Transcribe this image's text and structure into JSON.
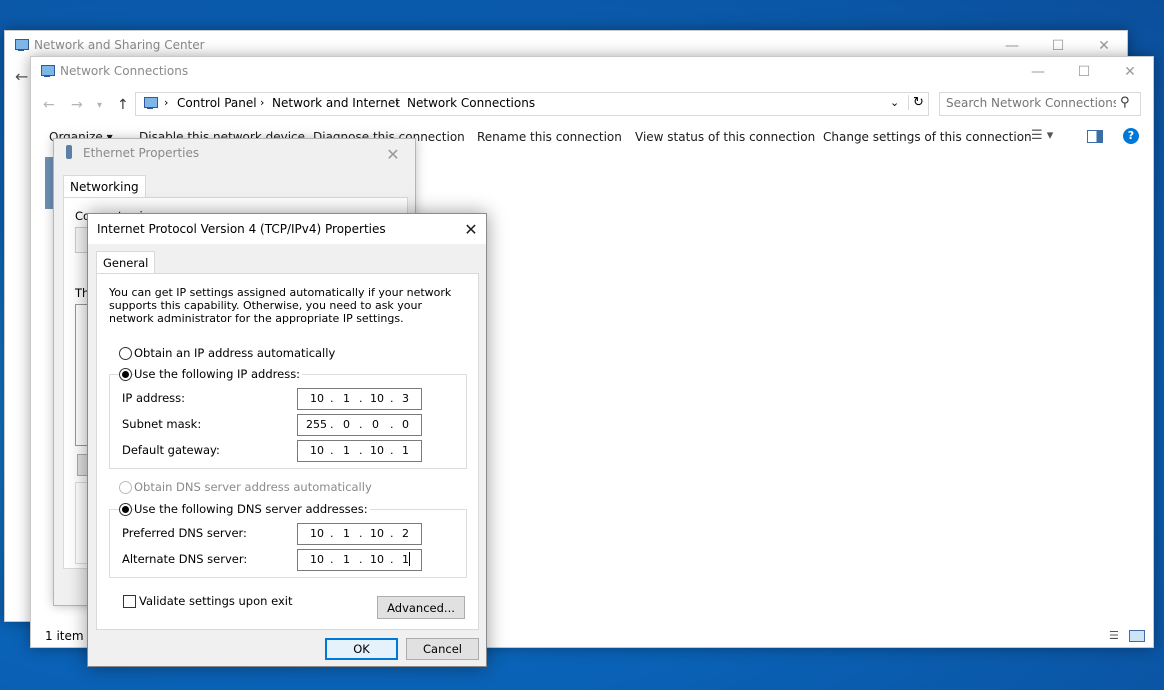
{
  "nsc_window": {
    "title": "Network and Sharing Center"
  },
  "nc_window": {
    "title": "Network Connections",
    "breadcrumb": [
      "Control Panel",
      "Network and Internet",
      "Network Connections"
    ],
    "search_placeholder": "Search Network Connections",
    "toolbar": [
      "Organize ▾",
      "Disable this network device",
      "Diagnose this connection",
      "Rename this connection",
      "View status of this connection",
      "Change settings of this connection"
    ],
    "status": "1 item"
  },
  "ethernet_dialog": {
    "title": "Ethernet Properties",
    "tab": "Networking",
    "connect_label": "Connect using:",
    "this_label": "Th"
  },
  "ipv4_dialog": {
    "title": "Internet Protocol Version 4 (TCP/IPv4) Properties",
    "tab": "General",
    "description": "You can get IP settings assigned automatically if your network supports this capability. Otherwise, you need to ask your network administrator for the appropriate IP settings.",
    "obtain_ip_auto": "Obtain an IP address automatically",
    "use_following_ip": "Use the following IP address:",
    "ip_label": "IP address:",
    "ip_value": [
      "10",
      "1",
      "10",
      "3"
    ],
    "subnet_label": "Subnet mask:",
    "subnet_value": [
      "255",
      "0",
      "0",
      "0"
    ],
    "gateway_label": "Default gateway:",
    "gateway_value": [
      "10",
      "1",
      "10",
      "1"
    ],
    "obtain_dns_auto": "Obtain DNS server address automatically",
    "use_following_dns": "Use the following DNS server addresses:",
    "preferred_dns_label": "Preferred DNS server:",
    "preferred_dns_value": [
      "10",
      "1",
      "10",
      "2"
    ],
    "alternate_dns_label": "Alternate DNS server:",
    "alternate_dns_value": [
      "10",
      "1",
      "10",
      "1"
    ],
    "validate_label": "Validate settings upon exit",
    "advanced_button": "Advanced...",
    "ok_button": "OK",
    "cancel_button": "Cancel"
  },
  "colors": {
    "accent": "#0078d7",
    "desktop": "#0a63b8"
  }
}
